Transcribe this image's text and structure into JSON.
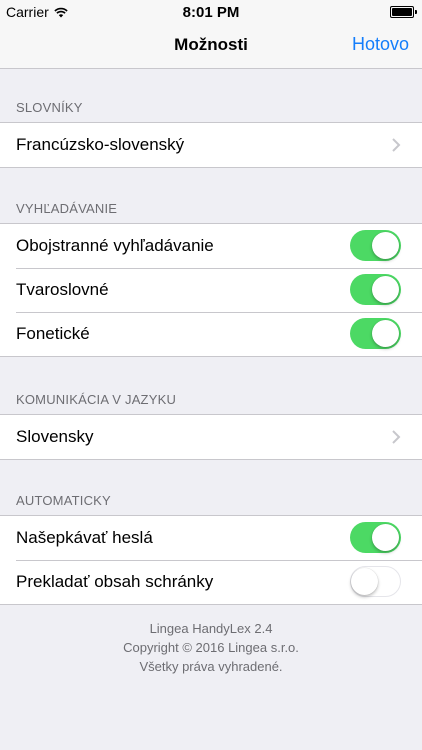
{
  "status_bar": {
    "carrier": "Carrier",
    "time": "8:01 PM"
  },
  "nav": {
    "title": "Možnosti",
    "done": "Hotovo"
  },
  "colors": {
    "accent": "#147efb",
    "switch_on": "#4cd964",
    "background": "#efeff4"
  },
  "sections": {
    "dictionaries": {
      "header": "SLOVNÍKY",
      "rows": [
        {
          "label": "Francúzsko-slovenský",
          "icon": "chevron-right-icon"
        }
      ]
    },
    "search": {
      "header": "VYHĽADÁVANIE",
      "rows": [
        {
          "label": "Obojstranné vyhľadávanie",
          "on": true
        },
        {
          "label": "Tvaroslovné",
          "on": true
        },
        {
          "label": "Fonetické",
          "on": true
        }
      ]
    },
    "language": {
      "header": "KOMUNIKÁCIA V JAZYKU",
      "rows": [
        {
          "label": "Slovensky",
          "icon": "chevron-right-icon"
        }
      ]
    },
    "automatic": {
      "header": "AUTOMATICKY",
      "rows": [
        {
          "label": "Našepkávať heslá",
          "on": true
        },
        {
          "label": "Prekladať obsah schránky",
          "on": false
        }
      ]
    }
  },
  "footer": {
    "line1": "Lingea HandyLex 2.4",
    "line2": "Copyright © 2016 Lingea s.r.o.",
    "line3": "Všetky práva vyhradené."
  }
}
